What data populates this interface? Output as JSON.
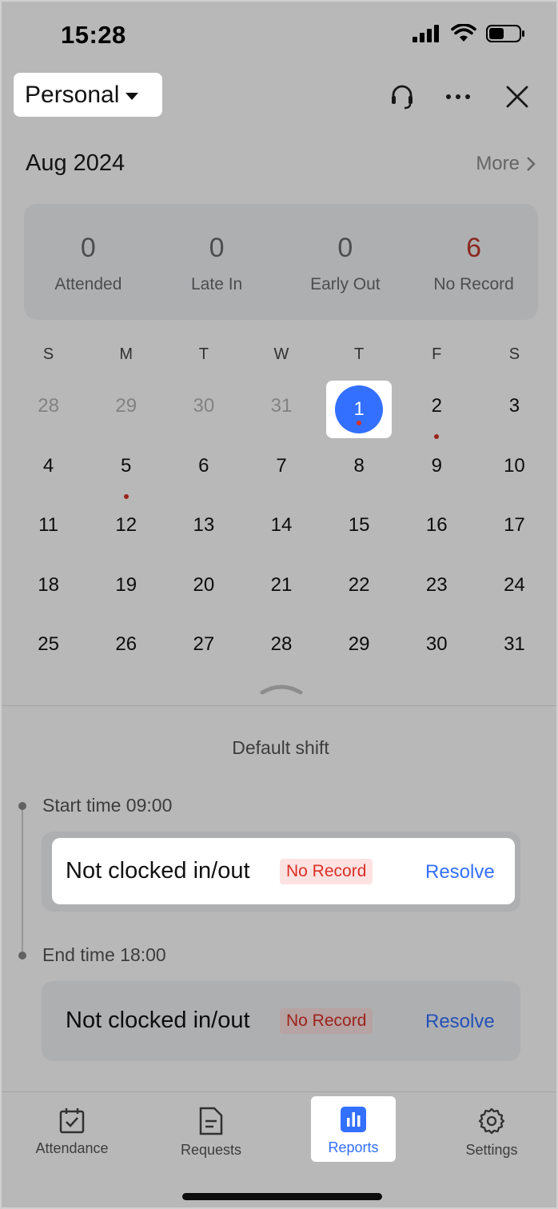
{
  "status_bar": {
    "time": "15:28"
  },
  "header": {
    "scope_label": "Personal",
    "icons": [
      "headset-icon",
      "more-icon",
      "close-icon"
    ]
  },
  "month": {
    "label": "Aug 2024",
    "more_label": "More"
  },
  "summary": [
    {
      "value": "0",
      "label": "Attended",
      "alert": false
    },
    {
      "value": "0",
      "label": "Late In",
      "alert": false
    },
    {
      "value": "0",
      "label": "Early Out",
      "alert": false
    },
    {
      "value": "6",
      "label": "No Record",
      "alert": true
    }
  ],
  "calendar": {
    "weekdays": [
      "S",
      "M",
      "T",
      "W",
      "T",
      "F",
      "S"
    ],
    "weeks": [
      [
        {
          "d": "28",
          "muted": true
        },
        {
          "d": "29",
          "muted": true
        },
        {
          "d": "30",
          "muted": true
        },
        {
          "d": "31",
          "muted": true
        },
        {
          "d": "1",
          "today": true,
          "dot": true
        },
        {
          "d": "2",
          "dot": true
        },
        {
          "d": "3"
        }
      ],
      [
        {
          "d": "4"
        },
        {
          "d": "5",
          "dot": true
        },
        {
          "d": "6"
        },
        {
          "d": "7"
        },
        {
          "d": "8"
        },
        {
          "d": "9"
        },
        {
          "d": "10"
        }
      ],
      [
        {
          "d": "11"
        },
        {
          "d": "12"
        },
        {
          "d": "13"
        },
        {
          "d": "14"
        },
        {
          "d": "15"
        },
        {
          "d": "16"
        },
        {
          "d": "17"
        }
      ],
      [
        {
          "d": "18"
        },
        {
          "d": "19"
        },
        {
          "d": "20"
        },
        {
          "d": "21"
        },
        {
          "d": "22"
        },
        {
          "d": "23"
        },
        {
          "d": "24"
        }
      ],
      [
        {
          "d": "25"
        },
        {
          "d": "26"
        },
        {
          "d": "27"
        },
        {
          "d": "28"
        },
        {
          "d": "29"
        },
        {
          "d": "30"
        },
        {
          "d": "31"
        }
      ]
    ]
  },
  "shift": {
    "title": "Default shift",
    "start_label": "Start time 09:00",
    "end_label": "End time 18:00",
    "start_record": {
      "text": "Not clocked in/out",
      "badge": "No Record",
      "action": "Resolve"
    },
    "end_record": {
      "text": "Not clocked in/out",
      "badge": "No Record",
      "action": "Resolve"
    }
  },
  "tabs": [
    {
      "label": "Attendance",
      "icon": "calendar-check-icon",
      "active": false
    },
    {
      "label": "Requests",
      "icon": "document-icon",
      "active": false
    },
    {
      "label": "Reports",
      "icon": "bar-chart-icon",
      "active": true
    },
    {
      "label": "Settings",
      "icon": "gear-icon",
      "active": false
    }
  ],
  "colors": {
    "accent": "#3370ff",
    "alert": "#d93025",
    "badge_bg": "#fde2e2"
  }
}
